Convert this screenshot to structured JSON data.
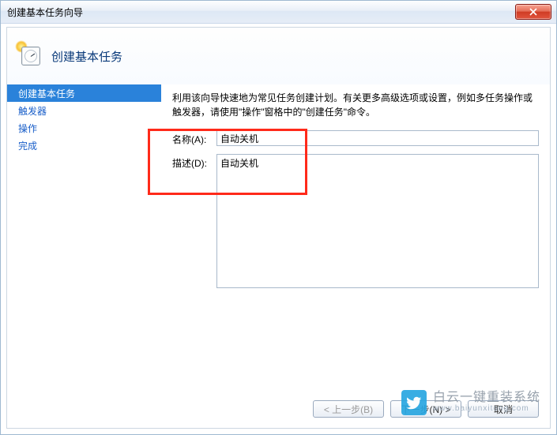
{
  "window": {
    "title": "创建基本任务向导"
  },
  "header": {
    "title": "创建基本任务"
  },
  "sidebar": {
    "items": [
      {
        "label": "创建基本任务",
        "selected": true
      },
      {
        "label": "触发器",
        "selected": false
      },
      {
        "label": "操作",
        "selected": false
      },
      {
        "label": "完成",
        "selected": false
      }
    ]
  },
  "main": {
    "intro": "利用该向导快速地为常见任务创建计划。有关更多高级选项或设置，例如多任务操作或触发器，请使用\"操作\"窗格中的\"创建任务\"命令。",
    "name_label": "名称(A):",
    "name_value": "自动关机",
    "desc_label": "描述(D):",
    "desc_value": "自动关机"
  },
  "buttons": {
    "back": "< 上一步(B)",
    "next": "下一步(N) >",
    "cancel": "取消"
  },
  "watermark": {
    "line1": "白云一键重装系统",
    "line2": "www.baiyunxitong.com"
  },
  "colors": {
    "accent": "#2a82da",
    "highlight": "#ff2a1a"
  }
}
